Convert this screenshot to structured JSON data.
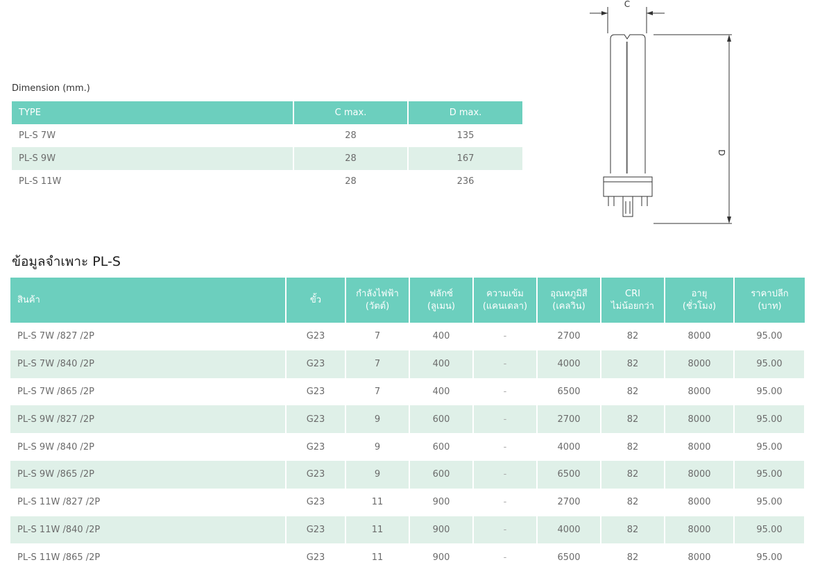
{
  "dimension": {
    "caption": "Dimension (mm.)",
    "headers": [
      "TYPE",
      "C max.",
      "D max."
    ],
    "rows": [
      [
        "PL-S 7W",
        "28",
        "135"
      ],
      [
        "PL-S 9W",
        "28",
        "167"
      ],
      [
        "PL-S 11W",
        "28",
        "236"
      ]
    ]
  },
  "diagram": {
    "label_c": "C",
    "label_d": "D"
  },
  "spec": {
    "title": "ข้อมูลจำเพาะ PL-S",
    "headers": [
      {
        "l1": "สินค้า",
        "l2": ""
      },
      {
        "l1": "ขั้ว",
        "l2": ""
      },
      {
        "l1": "กำลังไฟฟ้า",
        "l2": "(วัตต์)"
      },
      {
        "l1": "ฟลักซ์",
        "l2": "(ลูเมน)"
      },
      {
        "l1": "ความเข้ม",
        "l2": "(แคนเดลา)"
      },
      {
        "l1": "อุณหภูมิสี",
        "l2": "(เคลวิน)"
      },
      {
        "l1": "CRI",
        "l2": "ไม่น้อยกว่า"
      },
      {
        "l1": "อายุ",
        "l2": "(ชั่วโมง)"
      },
      {
        "l1": "ราคาปลีก",
        "l2": "(บาท)"
      }
    ],
    "rows": [
      [
        "PL-S 7W /827 /2P",
        "G23",
        "7",
        "400",
        "-",
        "2700",
        "82",
        "8000",
        "95.00"
      ],
      [
        "PL-S 7W /840 /2P",
        "G23",
        "7",
        "400",
        "-",
        "4000",
        "82",
        "8000",
        "95.00"
      ],
      [
        "PL-S 7W /865 /2P",
        "G23",
        "7",
        "400",
        "-",
        "6500",
        "82",
        "8000",
        "95.00"
      ],
      [
        "PL-S 9W /827 /2P",
        "G23",
        "9",
        "600",
        "-",
        "2700",
        "82",
        "8000",
        "95.00"
      ],
      [
        "PL-S 9W /840 /2P",
        "G23",
        "9",
        "600",
        "-",
        "4000",
        "82",
        "8000",
        "95.00"
      ],
      [
        "PL-S 9W /865 /2P",
        "G23",
        "9",
        "600",
        "-",
        "6500",
        "82",
        "8000",
        "95.00"
      ],
      [
        "PL-S 11W /827 /2P",
        "G23",
        "11",
        "900",
        "-",
        "2700",
        "82",
        "8000",
        "95.00"
      ],
      [
        "PL-S 11W /840 /2P",
        "G23",
        "11",
        "900",
        "-",
        "4000",
        "82",
        "8000",
        "95.00"
      ],
      [
        "PL-S 11W /865 /2P",
        "G23",
        "11",
        "900",
        "-",
        "6500",
        "82",
        "8000",
        "95.00"
      ]
    ]
  },
  "colors": {
    "header_bg": "#6ccfbe",
    "row_alt_bg": "#dff0e8",
    "text": "#6b6b6b"
  }
}
